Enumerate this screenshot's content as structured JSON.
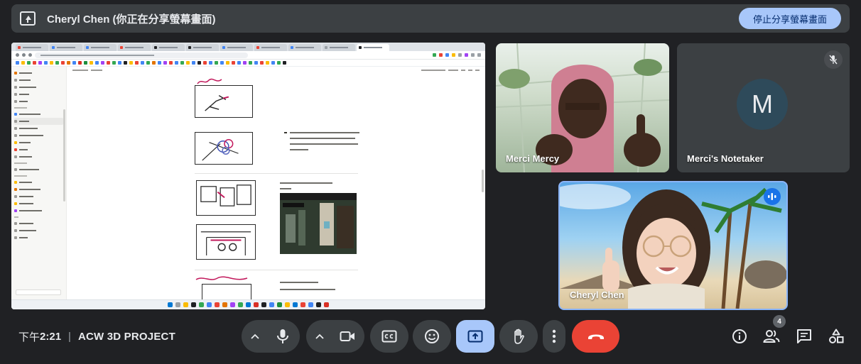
{
  "banner": {
    "title": "Cheryl Chen (你正在分享螢幕畫面)",
    "stop_label": "停止分享螢幕畫面"
  },
  "participants": [
    {
      "name": "Merci Mercy"
    },
    {
      "name": "Merci's Notetaker",
      "initial": "M"
    },
    {
      "name": "Cheryl Chen"
    }
  ],
  "meeting": {
    "time_prefix": "下午",
    "time": "2:21",
    "separator": "|",
    "title": "ACW 3D PROJECT"
  },
  "people_count": "4",
  "colors": {
    "background": "#202124",
    "control": "#3c4043",
    "accent": "#a8c7fa",
    "hangup": "#ea4335",
    "active_border": "#8ab4f8"
  },
  "icons": {
    "mic": "microphone-icon",
    "camera": "camera-icon",
    "captions": "captions-icon",
    "emoji": "emoji-icon",
    "present": "present-screen-icon",
    "hand": "raise-hand-icon",
    "more": "more-options-icon",
    "hangup": "hangup-icon",
    "info": "info-icon",
    "people": "people-icon",
    "chat": "chat-icon",
    "activities": "activities-icon"
  }
}
